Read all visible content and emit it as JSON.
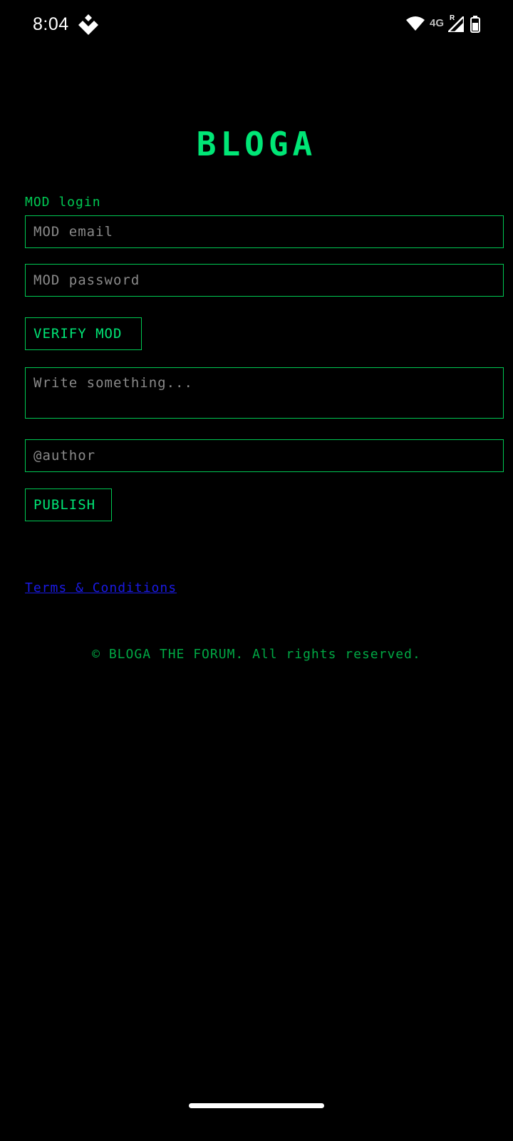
{
  "status_bar": {
    "time": "8:04",
    "network": "4G",
    "roaming": "R"
  },
  "brand": {
    "title": "BLOGA"
  },
  "login": {
    "label": "MOD login",
    "email_placeholder": "MOD email",
    "password_placeholder": "MOD password",
    "verify_label": "VERIFY MOD"
  },
  "post": {
    "body_placeholder": "Write something...",
    "author_placeholder": "@author",
    "publish_label": "PUBLISH"
  },
  "links": {
    "terms": "Terms & Conditions"
  },
  "footer": {
    "text": "© BLOGA THE FORUM. All rights reserved."
  },
  "colors": {
    "accent": "#00e676",
    "border": "#00c853",
    "link": "#1a1ae6",
    "background": "#000000"
  }
}
